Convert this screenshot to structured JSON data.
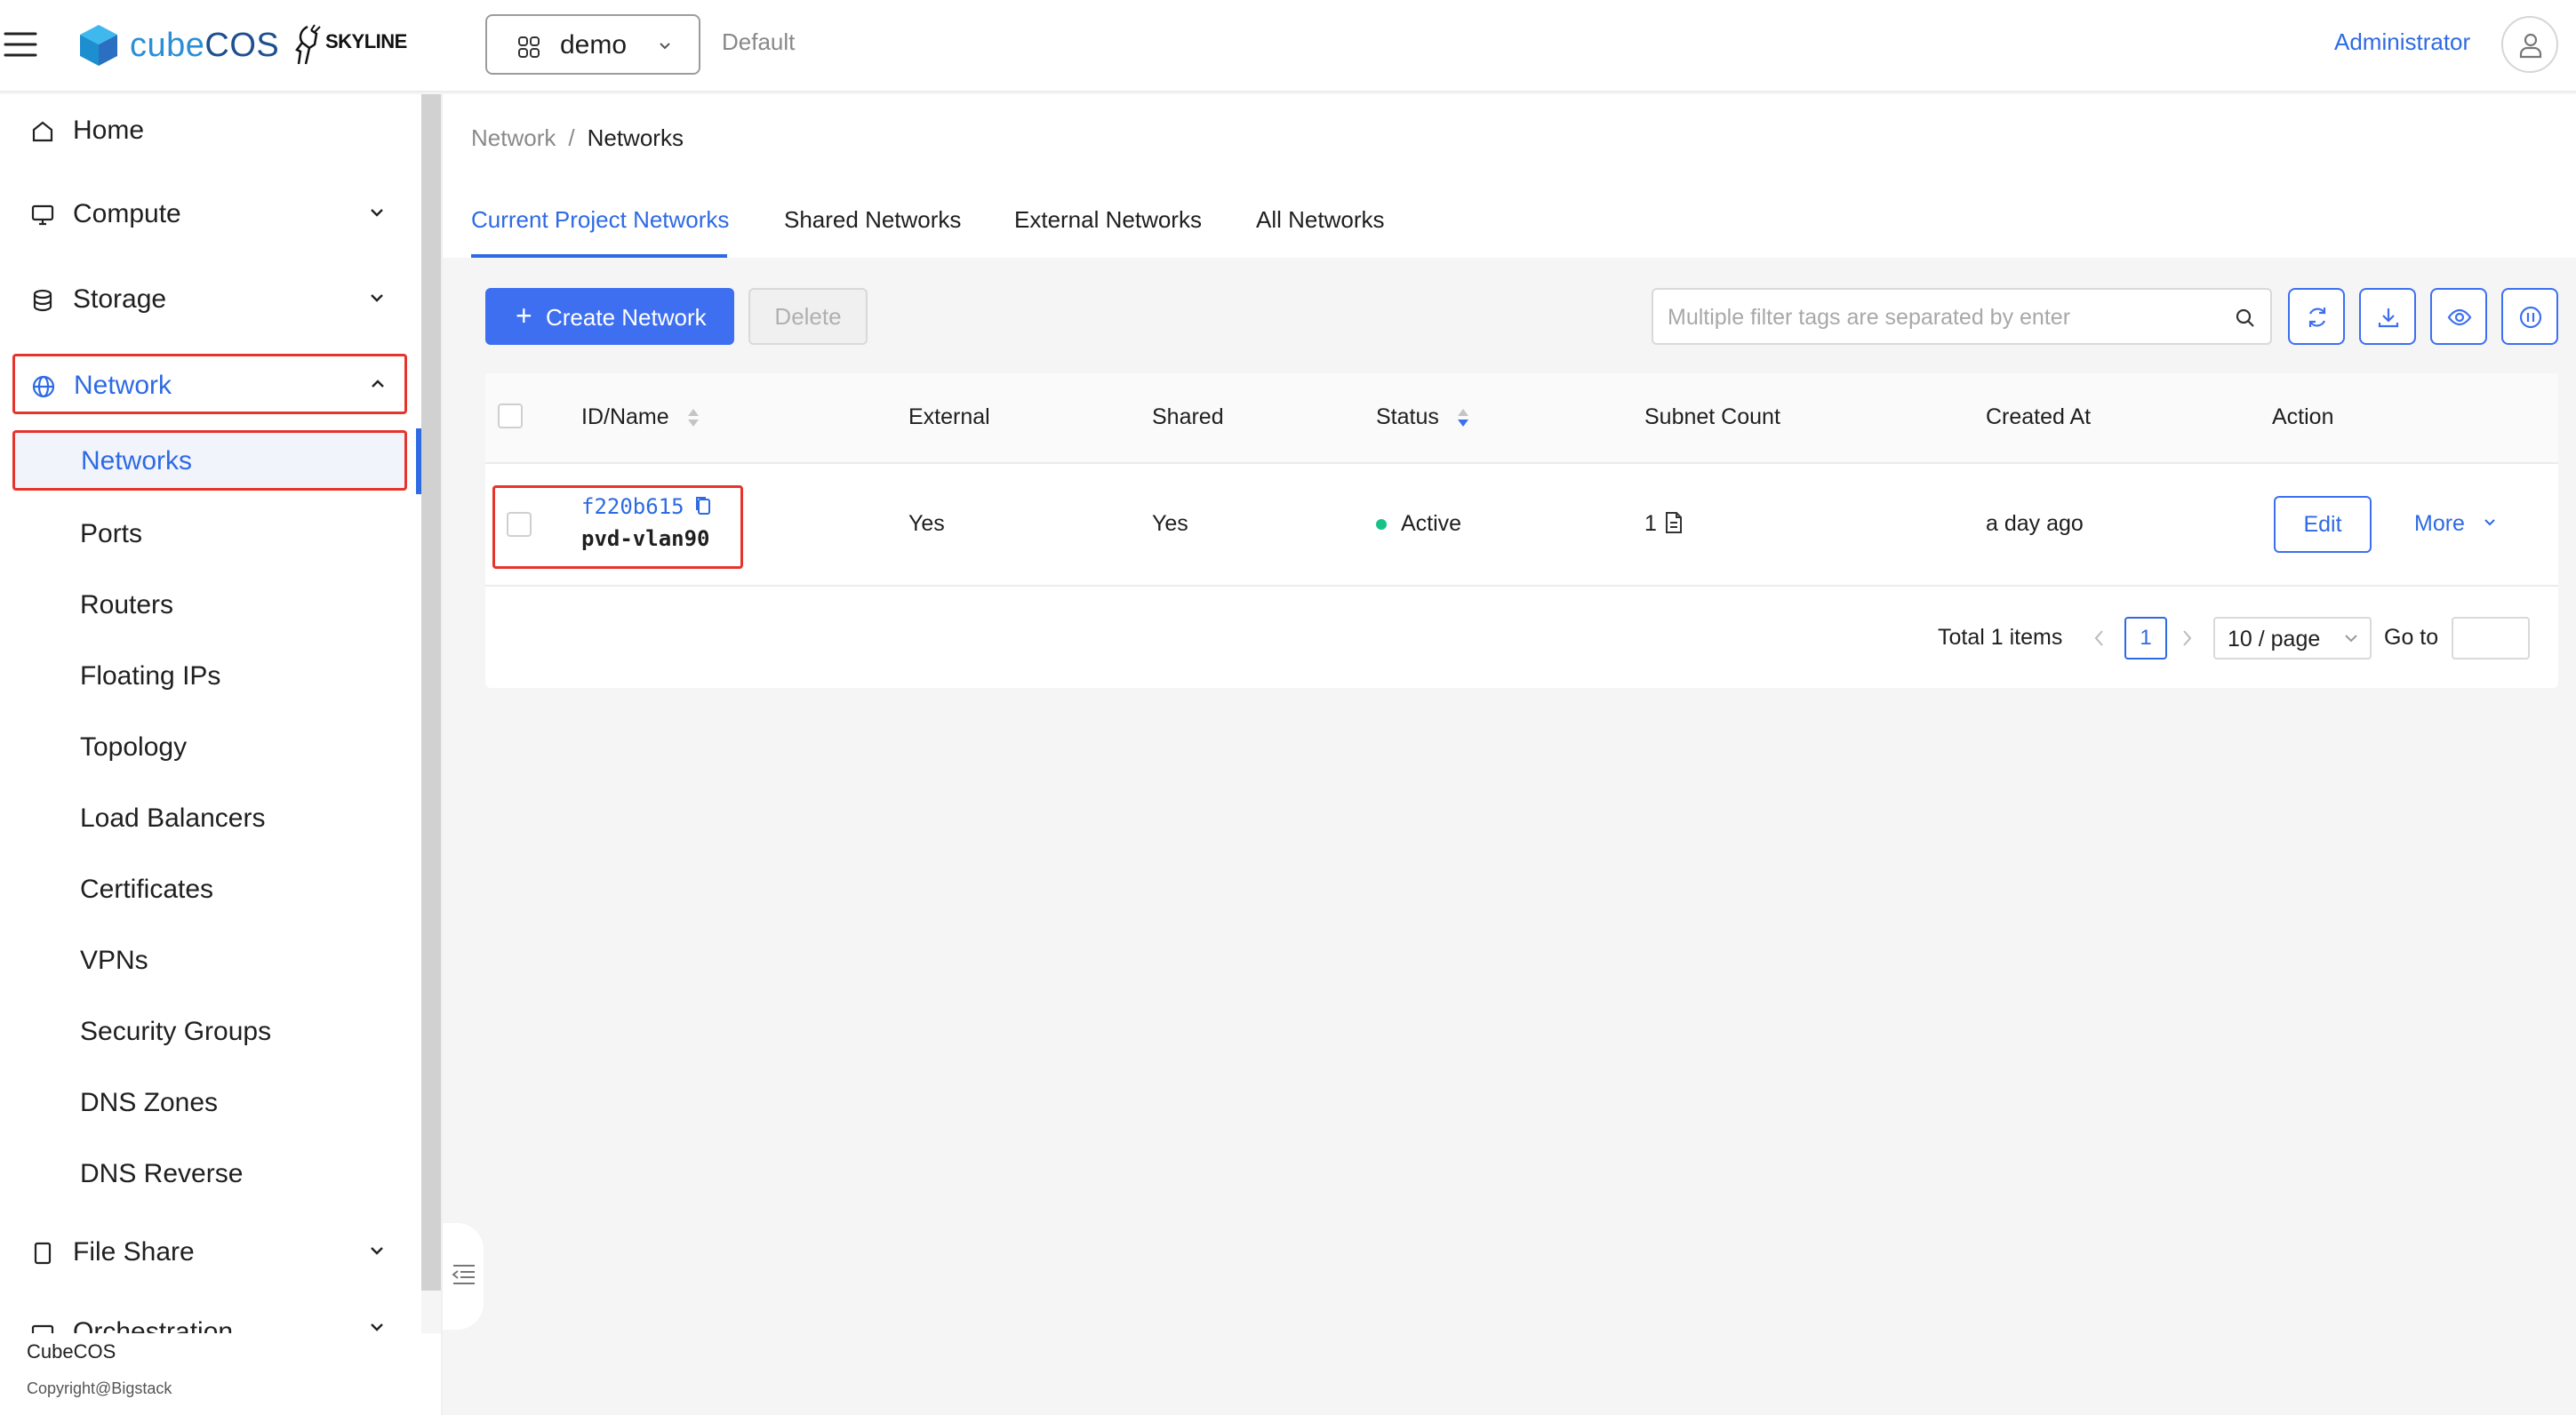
{
  "header": {
    "brand_prefix": "cube",
    "brand_suffix": "COS",
    "skyline_text": "SKYLINE",
    "project": "demo",
    "domain": "Default",
    "user": "Administrator"
  },
  "sidebar": {
    "items": [
      {
        "label": "Home",
        "icon": "home-icon"
      },
      {
        "label": "Compute",
        "icon": "monitor-icon"
      },
      {
        "label": "Storage",
        "icon": "database-icon"
      },
      {
        "label": "Network",
        "icon": "globe-icon"
      }
    ],
    "network_children": [
      "Networks",
      "Ports",
      "Routers",
      "Floating IPs",
      "Topology",
      "Load Balancers",
      "Certificates",
      "VPNs",
      "Security Groups",
      "DNS Zones",
      "DNS Reverse"
    ],
    "file_share": "File Share",
    "orchestration": "Orchestration",
    "footer_name": "CubeCOS",
    "footer_copyright": "Copyright@Bigstack"
  },
  "breadcrumb": {
    "parent": "Network",
    "separator": "/",
    "current": "Networks"
  },
  "tabs": [
    {
      "label": "Current Project Networks",
      "active": true
    },
    {
      "label": "Shared Networks",
      "active": false
    },
    {
      "label": "External Networks",
      "active": false
    },
    {
      "label": "All Networks",
      "active": false
    }
  ],
  "toolbar": {
    "create_plus": "+",
    "create_label": "Create Network",
    "delete_label": "Delete",
    "search_placeholder": "Multiple filter tags are separated by enter"
  },
  "table": {
    "columns": [
      "ID/Name",
      "External",
      "Shared",
      "Status",
      "Subnet Count",
      "Created At",
      "Action"
    ],
    "rows": [
      {
        "id": "f220b615",
        "name": "pvd-vlan90",
        "external": "Yes",
        "shared": "Yes",
        "status": "Active",
        "subnet_count": "1",
        "created_at": "a day ago",
        "edit_label": "Edit",
        "more_label": "More"
      }
    ]
  },
  "pagination": {
    "total": "Total 1 items",
    "current_page": "1",
    "page_size": "10 / page",
    "goto_label": "Go to"
  },
  "colors": {
    "accent": "#2d6ae3",
    "primary_button": "#3d6ff0",
    "highlight_border": "#e6342c",
    "status_active": "#17c28a"
  }
}
